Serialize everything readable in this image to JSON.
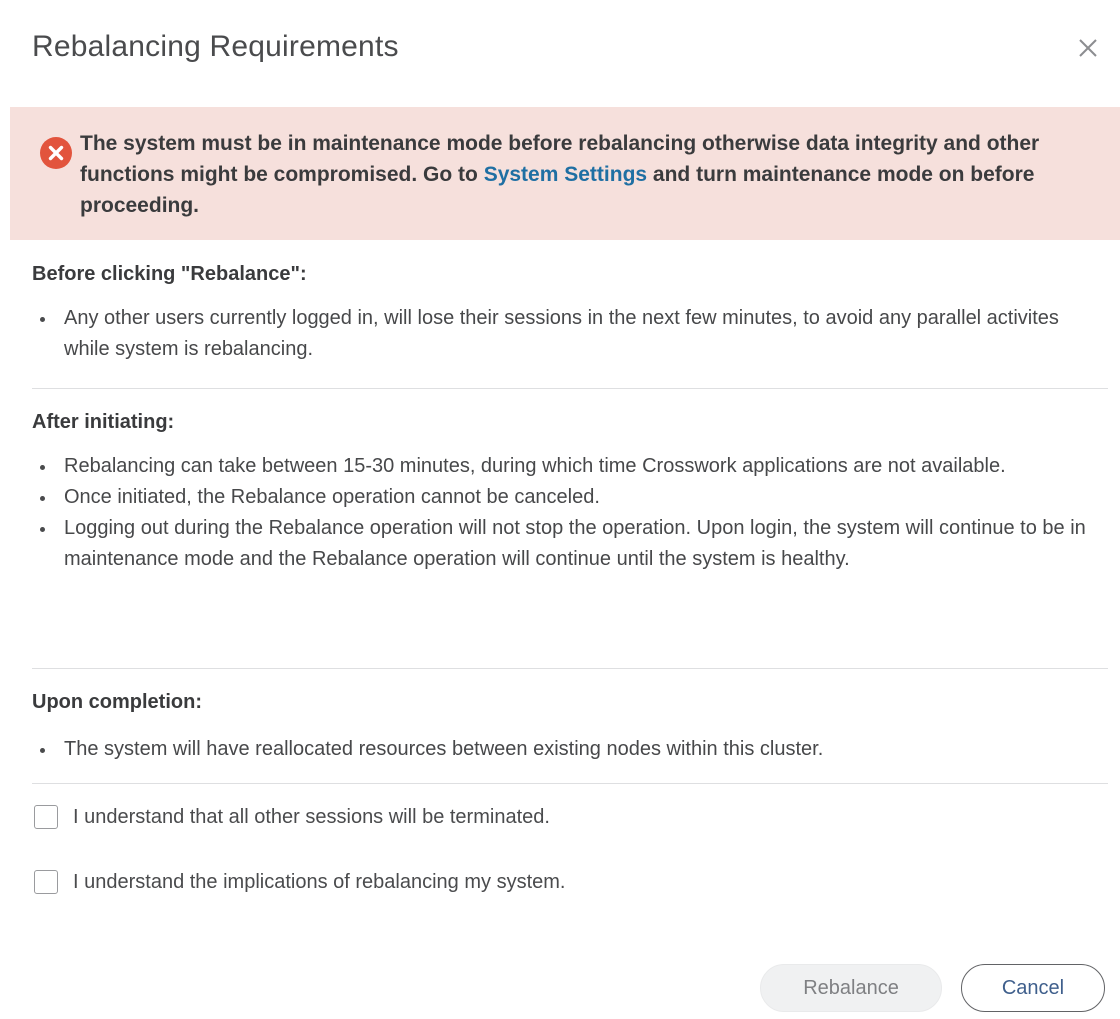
{
  "dialog": {
    "title": "Rebalancing Requirements",
    "close_icon": "close-icon"
  },
  "alert": {
    "icon": "error-icon",
    "text_before_link": "The system must be in maintenance mode before rebalancing otherwise data integrity and other functions might be compromised. Go to ",
    "link_text": "System Settings",
    "text_after_link": " and turn maintenance mode on before proceeding.",
    "background_color": "#f6e0dc",
    "icon_color": "#e2543d",
    "link_color": "#1f6fa3"
  },
  "sections": [
    {
      "title": "Before clicking \"Rebalance\":",
      "items": [
        "Any other users currently logged in, will lose their sessions in the next few minutes, to avoid any parallel activites while system is rebalancing."
      ]
    },
    {
      "title": "After initiating:",
      "items": [
        "Rebalancing can take between 15-30 minutes, during which time Crosswork applications are not available.",
        "Once initiated, the Rebalance operation cannot be canceled.",
        "Logging out during the Rebalance operation will not stop the operation. Upon login, the system will continue to be in maintenance mode and the Rebalance operation will continue until the system is healthy."
      ]
    },
    {
      "title": "Upon completion:",
      "items": [
        "The system will have reallocated resources between existing nodes within this cluster."
      ]
    }
  ],
  "checkboxes": [
    {
      "label": "I understand that all other sessions will be terminated.",
      "checked": false
    },
    {
      "label": "I understand the implications of rebalancing my system.",
      "checked": false
    }
  ],
  "buttons": {
    "rebalance_label": "Rebalance",
    "rebalance_disabled": true,
    "cancel_label": "Cancel"
  }
}
